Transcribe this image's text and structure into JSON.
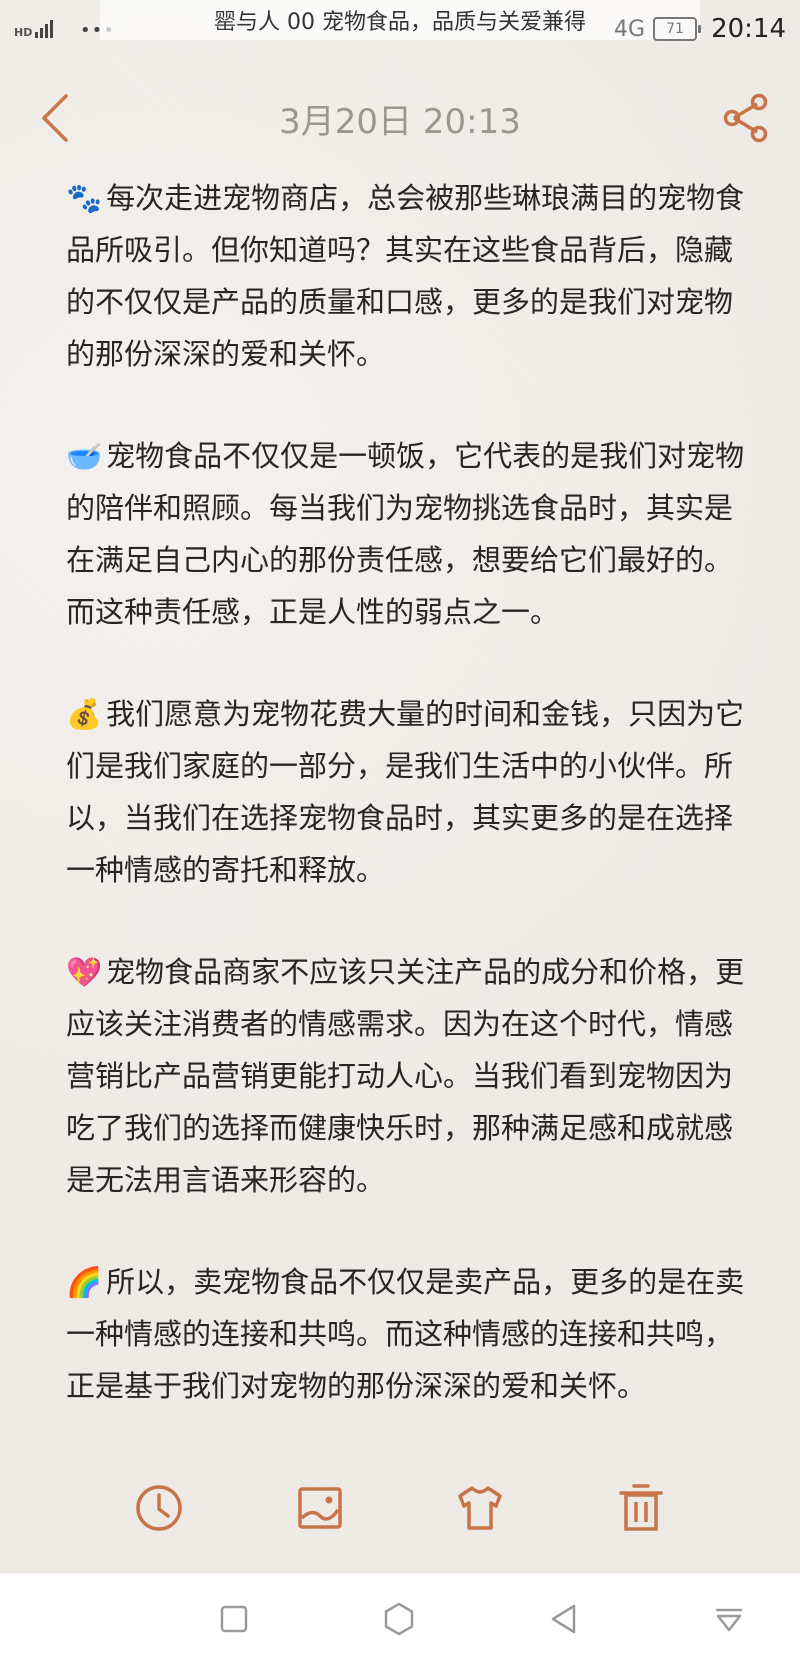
{
  "status_bar": {
    "hd": "HD",
    "dots": "•••",
    "notification": "罂与人 00 宠物食品，品质与关爱兼得",
    "network": "4G",
    "battery": "71",
    "time": "20:14"
  },
  "header": {
    "title": "3月20日 20:13",
    "back_icon": "chevron-left-icon",
    "share_icon": "share-icon"
  },
  "note": {
    "paragraphs": [
      {
        "emoji": "🐾",
        "text": "每次走进宠物商店，总会被那些琳琅满目的宠物食品所吸引。但你知道吗？其实在这些食品背后，隐藏的不仅仅是产品的质量和口感，更多的是我们对宠物的那份深深的爱和关怀。"
      },
      {
        "emoji": "🥣",
        "text": "宠物食品不仅仅是一顿饭，它代表的是我们对宠物的陪伴和照顾。每当我们为宠物挑选食品时，其实是在满足自己内心的那份责任感，想要给它们最好的。而这种责任感，正是人性的弱点之一。"
      },
      {
        "emoji": "💰",
        "text": "我们愿意为宠物花费大量的时间和金钱，只因为它们是我们家庭的一部分，是我们生活中的小伙伴。所以，当我们在选择宠物食品时，其实更多的是在选择一种情感的寄托和释放。"
      },
      {
        "emoji": "💖",
        "text": "宠物食品商家不应该只关注产品的成分和价格，更应该关注消费者的情感需求。因为在这个时代，情感营销比产品营销更能打动人心。当我们看到宠物因为吃了我们的选择而健康快乐时，那种满足感和成就感是无法用言语来形容的。"
      },
      {
        "emoji": "🌈",
        "text": "所以，卖宠物食品不仅仅是卖产品，更多的是在卖一种情感的连接和共鸣。而这种情感的连接和共鸣，正是基于我们对宠物的那份深深的爱和关怀。"
      }
    ]
  },
  "toolbar": {
    "items": [
      "clock-icon",
      "image-icon",
      "shirt-icon",
      "trash-icon"
    ]
  },
  "nav_bar": {
    "items": [
      "square-icon",
      "hexagon-icon",
      "back-triangle-icon",
      "notification-shade-icon"
    ]
  },
  "colors": {
    "accent": "#c8744a",
    "background": "#efebe6",
    "title": "#9c9691",
    "text": "#2a2522"
  }
}
